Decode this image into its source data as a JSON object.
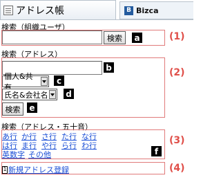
{
  "header": {
    "title": "アドレス帳",
    "brand": "Bizca",
    "brand_logo": "B"
  },
  "section1": {
    "label": "検索（組織ユーザ）",
    "search_value": "",
    "button": "検索",
    "badge": "a",
    "marker": "(1)"
  },
  "section2": {
    "label": "検索（アドレス）",
    "search_value": "",
    "badge_input": "b",
    "select1": "個人&共有",
    "badge_select1": "c",
    "select2": "氏名&会社名",
    "badge_select2": "d",
    "button": "検索",
    "badge_button": "e",
    "marker": "(2)"
  },
  "section3": {
    "label": "検索（アドレス・五十音）",
    "rows": [
      [
        "あ行",
        "か行",
        "さ行",
        "た行",
        "な行"
      ],
      [
        "は行",
        "ま行",
        "や行",
        "ら行",
        "わ行"
      ],
      [
        "英数字",
        "その他"
      ]
    ],
    "badge": "f",
    "marker": "(3)"
  },
  "section4": {
    "key": "1",
    "link": "新規アドレス登録",
    "marker": "(4)"
  },
  "colors": {
    "outline": "#e07a7a",
    "marker": "#e0504a",
    "link": "#1a4fd6"
  }
}
